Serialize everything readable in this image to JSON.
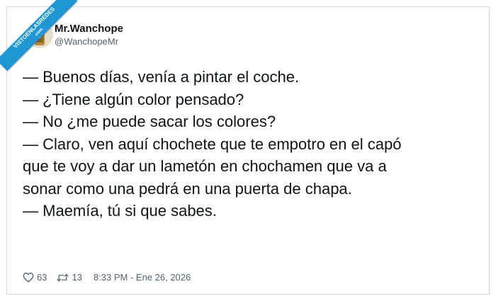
{
  "watermark": {
    "line1": "VISTOENLASREDES",
    "line2": ".com"
  },
  "author": {
    "name": "Mr.Wanchope",
    "handle": "@WanchopeMr"
  },
  "tweet": {
    "lines": [
      "— Buenos días, venía a pintar el coche.",
      "— ¿Tiene algún color pensado?",
      "— No ¿me puede sacar los colores?",
      "— Claro, ven aquí chochete que te empotro en el capó",
      "que te voy a dar un lametón en chochamen que va a",
      "sonar como una pedrá en una puerta de chapa.",
      "— Maemía, tú si que sabes."
    ]
  },
  "stats": {
    "likes": "63",
    "retweets": "13",
    "timestamp": "8:33 PM - Ene 26, 2026",
    "like_icon": "heart-icon",
    "retweet_icon": "retweet-icon"
  },
  "colors": {
    "text": "#0f1419",
    "secondary": "#536471",
    "border": "#cfd9de",
    "ribbon": "#1f97d4"
  }
}
